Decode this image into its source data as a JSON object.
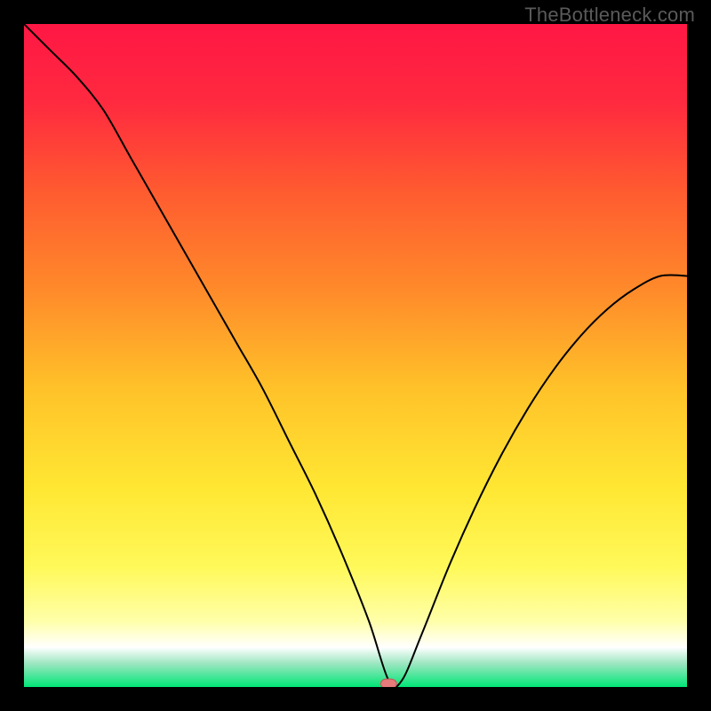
{
  "watermark": "TheBottleneck.com",
  "colors": {
    "frame": "#000000",
    "watermark": "#5a5a5a",
    "curve": "#000000",
    "marker_fill": "#e77a7a",
    "marker_stroke": "#c65a5a",
    "gradient_stops": [
      {
        "offset": 0.0,
        "color": "#ff1744"
      },
      {
        "offset": 0.12,
        "color": "#ff2a3f"
      },
      {
        "offset": 0.25,
        "color": "#ff5a30"
      },
      {
        "offset": 0.4,
        "color": "#ff8a2a"
      },
      {
        "offset": 0.55,
        "color": "#ffc229"
      },
      {
        "offset": 0.7,
        "color": "#ffe733"
      },
      {
        "offset": 0.82,
        "color": "#fff95a"
      },
      {
        "offset": 0.9,
        "color": "#ffffa8"
      },
      {
        "offset": 0.94,
        "color": "#ffffff"
      },
      {
        "offset": 0.965,
        "color": "#9be6c0"
      },
      {
        "offset": 1.0,
        "color": "#00e676"
      }
    ]
  },
  "chart_data": {
    "type": "line",
    "title": "",
    "xlabel": "",
    "ylabel": "",
    "xlim": [
      0,
      100
    ],
    "ylim": [
      0,
      100
    ],
    "grid": false,
    "legend": false,
    "marker": {
      "x": 55,
      "y": 0,
      "shape": "rounded-rect"
    },
    "series": [
      {
        "name": "bottleneck-curve",
        "x": [
          0,
          4,
          8,
          12,
          16,
          20,
          24,
          28,
          32,
          36,
          40,
          44,
          48,
          52,
          55,
          57,
          60,
          64,
          68,
          72,
          76,
          80,
          84,
          88,
          92,
          96,
          100
        ],
        "y": [
          100,
          96,
          92,
          87,
          80,
          73,
          66,
          59,
          52,
          45,
          37,
          29,
          20,
          10,
          1,
          1,
          8,
          18,
          27,
          35,
          42,
          48,
          53,
          57,
          60,
          62,
          62
        ]
      }
    ]
  }
}
